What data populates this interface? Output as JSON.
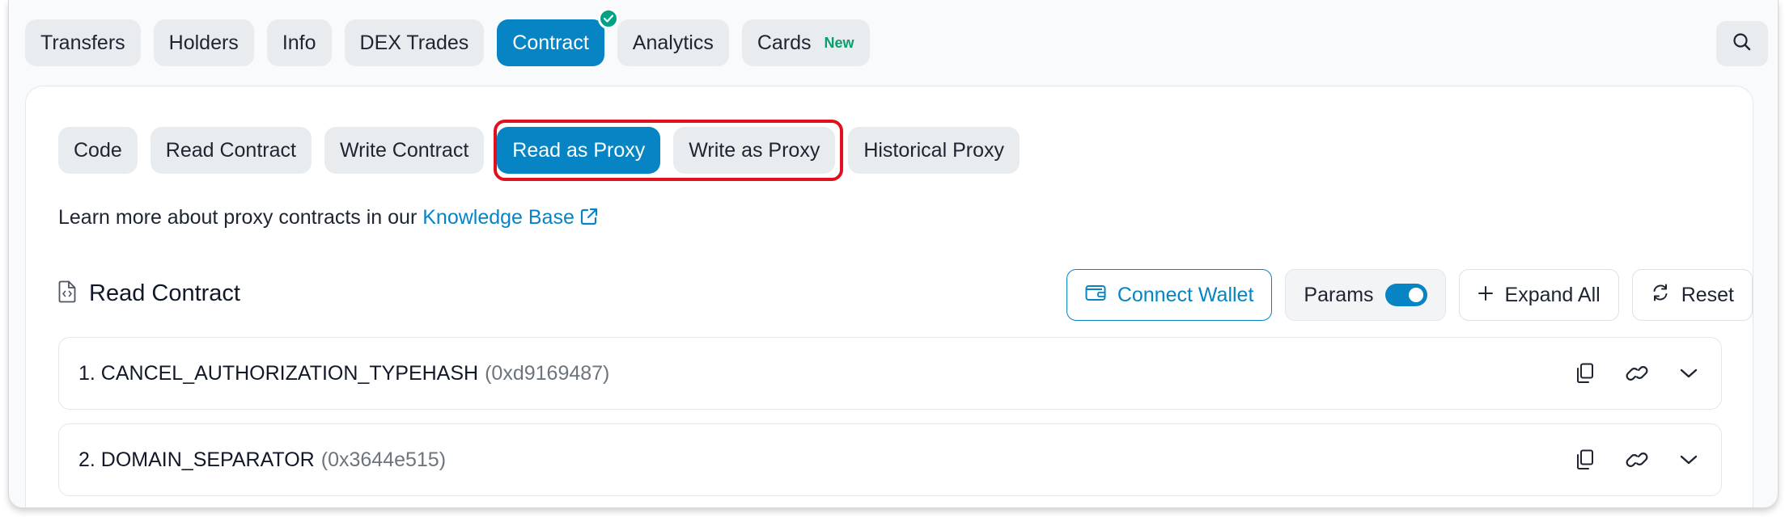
{
  "top_tabs": [
    {
      "label": "Transfers"
    },
    {
      "label": "Holders"
    },
    {
      "label": "Info"
    },
    {
      "label": "DEX Trades"
    },
    {
      "label": "Contract",
      "active": true,
      "verified": true
    },
    {
      "label": "Analytics"
    },
    {
      "label": "Cards",
      "badge": "New"
    }
  ],
  "search": {
    "icon": "search-icon"
  },
  "sub_tabs": [
    {
      "label": "Code"
    },
    {
      "label": "Read Contract"
    },
    {
      "label": "Write Contract"
    },
    {
      "label": "Read as Proxy",
      "active": true
    },
    {
      "label": "Write as Proxy"
    },
    {
      "label": "Historical Proxy"
    }
  ],
  "proxy_note": {
    "text": "Learn more about proxy contracts in our ",
    "link_label": "Knowledge Base"
  },
  "section": {
    "title": "Read Contract",
    "icon": "code-file-icon"
  },
  "actions": {
    "connect_wallet": "Connect Wallet",
    "params": "Params",
    "params_enabled": true,
    "expand_all": "Expand All",
    "reset": "Reset"
  },
  "functions": [
    {
      "name": "1. CANCEL_AUTHORIZATION_TYPEHASH",
      "selector": "(0xd9169487)"
    },
    {
      "name": "2. DOMAIN_SEPARATOR",
      "selector": "(0x3644e515)"
    }
  ],
  "colors": {
    "accent": "#0784c3",
    "highlight": "#e0101e",
    "verified": "#00a186",
    "new_badge": "#0b9d6d"
  }
}
